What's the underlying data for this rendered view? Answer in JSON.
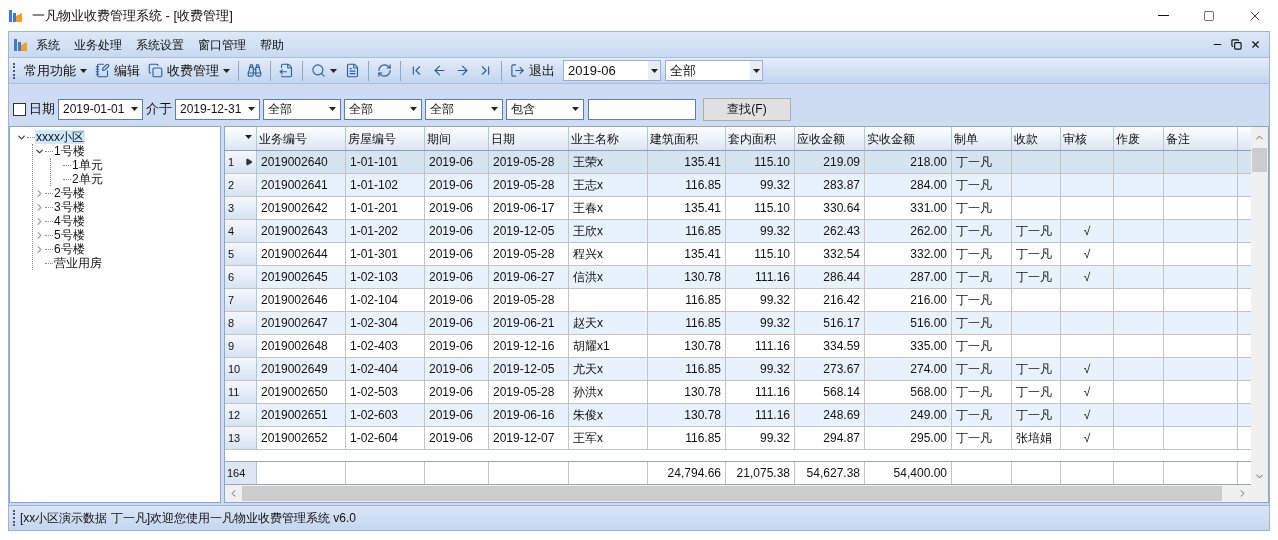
{
  "window": {
    "title": "一凡物业收费管理系统 - [收费管理]"
  },
  "menu": [
    "系统",
    "业务处理",
    "系统设置",
    "窗口管理",
    "帮助"
  ],
  "toolbar": [
    {
      "kind": "menu",
      "label": "常用功能"
    },
    {
      "kind": "text",
      "label": "编辑"
    },
    {
      "kind": "menu",
      "label": "收费管理"
    },
    {
      "kind": "sep"
    },
    {
      "kind": "icon"
    },
    {
      "kind": "sep"
    },
    {
      "kind": "icon"
    },
    {
      "kind": "sep"
    },
    {
      "kind": "iconmenu"
    },
    {
      "kind": "icon"
    },
    {
      "kind": "sep"
    },
    {
      "kind": "icon"
    },
    {
      "kind": "sep"
    },
    {
      "kind": "icon"
    },
    {
      "kind": "icon"
    },
    {
      "kind": "icon"
    },
    {
      "kind": "icon"
    },
    {
      "kind": "sep"
    },
    {
      "kind": "text",
      "label": "退出"
    },
    {
      "kind": "select",
      "value": "2019-06"
    },
    {
      "kind": "select",
      "value": "全部"
    }
  ],
  "filter": {
    "date_checkbox": {
      "label": "日期",
      "checked": false
    },
    "date_from": "2019-01-01",
    "between": "介于",
    "date_to": "2019-12-31",
    "selects": [
      "全部",
      "全部",
      "全部",
      "包含"
    ],
    "search_button": "查找(F)"
  },
  "tree": [
    {
      "label": "xxxx小区",
      "expanded": true,
      "selected": true,
      "children": [
        {
          "label": "1号楼",
          "expanded": true,
          "selected": false,
          "children": [
            {
              "label": "1单元",
              "selected": false
            },
            {
              "label": "2单元",
              "selected": false
            }
          ]
        },
        {
          "label": "2号楼",
          "expanded": false,
          "selected": false
        },
        {
          "label": "3号楼",
          "expanded": false,
          "selected": false
        },
        {
          "label": "4号楼",
          "expanded": false,
          "selected": false
        },
        {
          "label": "5号楼",
          "expanded": false,
          "selected": false
        },
        {
          "label": "6号楼",
          "expanded": false,
          "selected": false
        },
        {
          "label": "营业用房",
          "selected": false
        }
      ]
    }
  ],
  "table": {
    "columns": [
      "业务编号",
      "房屋编号",
      "期间",
      "日期",
      "业主名称",
      "建筑面积",
      "套内面积",
      "应收金额",
      "实收金额",
      "制单",
      "收款",
      "审核",
      "作废",
      "备注"
    ],
    "rows": [
      {
        "no": "1",
        "selected": true,
        "cells": [
          "2019002640",
          "1-01-101",
          "2019-06",
          "2019-05-28",
          "王荣x",
          "135.41",
          "115.10",
          "219.09",
          "218.00",
          "丁一凡",
          null,
          null,
          null,
          null
        ]
      },
      {
        "no": "2",
        "selected": false,
        "cells": [
          "2019002641",
          "1-01-102",
          "2019-06",
          "2019-05-28",
          "王志x",
          "116.85",
          "99.32",
          "283.87",
          "284.00",
          "丁一凡",
          null,
          null,
          null,
          null
        ]
      },
      {
        "no": "3",
        "selected": false,
        "cells": [
          "2019002642",
          "1-01-201",
          "2019-06",
          "2019-06-17",
          "王春x",
          "135.41",
          "115.10",
          "330.64",
          "331.00",
          "丁一凡",
          null,
          null,
          null,
          null
        ]
      },
      {
        "no": "4",
        "selected": false,
        "cells": [
          "2019002643",
          "1-01-202",
          "2019-06",
          "2019-12-05",
          "王欣x",
          "116.85",
          "99.32",
          "262.43",
          "262.00",
          "丁一凡",
          "丁一凡",
          "√",
          null,
          null
        ]
      },
      {
        "no": "5",
        "selected": false,
        "cells": [
          "2019002644",
          "1-01-301",
          "2019-06",
          "2019-05-28",
          "程兴x",
          "135.41",
          "115.10",
          "332.54",
          "332.00",
          "丁一凡",
          "丁一凡",
          "√",
          null,
          null
        ]
      },
      {
        "no": "6",
        "selected": false,
        "cells": [
          "2019002645",
          "1-02-103",
          "2019-06",
          "2019-06-27",
          "信洪x",
          "130.78",
          "111.16",
          "286.44",
          "287.00",
          "丁一凡",
          "丁一凡",
          "√",
          null,
          null
        ]
      },
      {
        "no": "7",
        "selected": false,
        "cells": [
          "2019002646",
          "1-02-104",
          "2019-06",
          "2019-05-28",
          null,
          "116.85",
          "99.32",
          "216.42",
          "216.00",
          "丁一凡",
          null,
          null,
          null,
          null
        ]
      },
      {
        "no": "8",
        "selected": false,
        "cells": [
          "2019002647",
          "1-02-304",
          "2019-06",
          "2019-06-21",
          "赵天x",
          "116.85",
          "99.32",
          "516.17",
          "516.00",
          "丁一凡",
          null,
          null,
          null,
          null
        ]
      },
      {
        "no": "9",
        "selected": false,
        "cells": [
          "2019002648",
          "1-02-403",
          "2019-06",
          "2019-12-16",
          "胡耀x1",
          "130.78",
          "111.16",
          "334.59",
          "335.00",
          "丁一凡",
          null,
          null,
          null,
          null
        ]
      },
      {
        "no": "10",
        "selected": false,
        "cells": [
          "2019002649",
          "1-02-404",
          "2019-06",
          "2019-12-05",
          "尤天x",
          "116.85",
          "99.32",
          "273.67",
          "274.00",
          "丁一凡",
          "丁一凡",
          "√",
          null,
          null
        ]
      },
      {
        "no": "11",
        "selected": false,
        "cells": [
          "2019002650",
          "1-02-503",
          "2019-06",
          "2019-05-28",
          "孙洪x",
          "130.78",
          "111.16",
          "568.14",
          "568.00",
          "丁一凡",
          "丁一凡",
          "√",
          null,
          null
        ]
      },
      {
        "no": "12",
        "selected": false,
        "cells": [
          "2019002651",
          "1-02-603",
          "2019-06",
          "2019-06-16",
          "朱俊x",
          "130.78",
          "111.16",
          "248.69",
          "249.00",
          "丁一凡",
          "丁一凡",
          "√",
          null,
          null
        ]
      },
      {
        "no": "13",
        "selected": false,
        "cells": [
          "2019002652",
          "1-02-604",
          "2019-06",
          "2019-12-07",
          "王军x",
          "116.85",
          "99.32",
          "294.87",
          "295.00",
          "丁一凡",
          "张培娟",
          "√",
          null,
          null
        ]
      }
    ],
    "footer": {
      "count": "164",
      "cells": [
        null,
        null,
        null,
        null,
        null,
        "24,794.66",
        "21,075.38",
        "54,627.38",
        "54,400.00",
        null,
        null,
        null,
        null,
        null
      ]
    }
  },
  "status_bar": "[xx小区演示数据 丁一凡]欢迎您使用一凡物业收费管理系统 v6.0"
}
